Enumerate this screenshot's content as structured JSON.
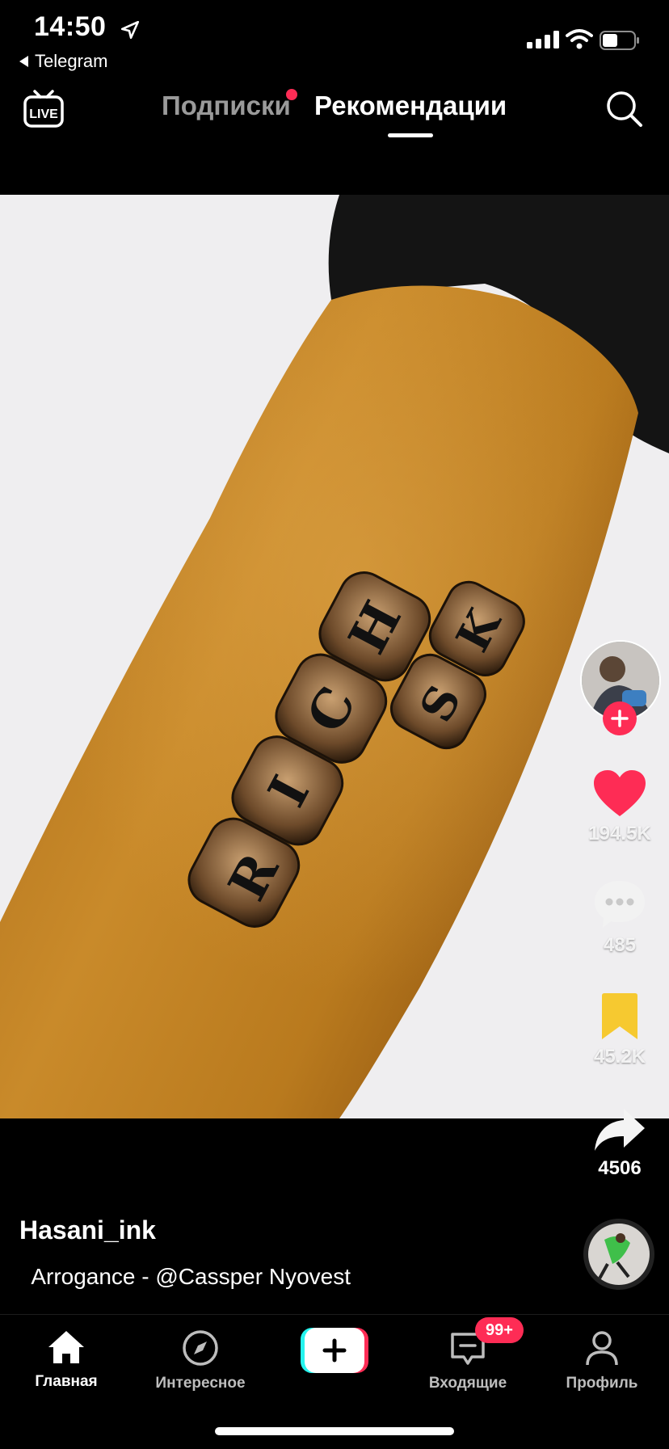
{
  "status": {
    "time": "14:50",
    "back_app": "Telegram"
  },
  "top_nav": {
    "live_label": "LIVE",
    "following": "Подписки",
    "for_you": "Рекомендации",
    "active_tab": "for_you"
  },
  "video": {
    "tattoo_letters": [
      "R",
      "I",
      "C",
      "H",
      "R",
      "I",
      "S",
      "K"
    ]
  },
  "actions": {
    "likes": "194.5K",
    "comments": "485",
    "saves": "45.2K",
    "shares": "4506"
  },
  "post": {
    "author": "Hasani_ink",
    "music": "Arrogance - @Cassper Nyovest"
  },
  "tabbar": {
    "home": "Главная",
    "discover": "Интересное",
    "inbox": "Входящие",
    "inbox_badge": "99+",
    "profile": "Профиль"
  },
  "colors": {
    "accent": "#fe2c55",
    "bookmark": "#f6c930",
    "background": "#000000"
  }
}
